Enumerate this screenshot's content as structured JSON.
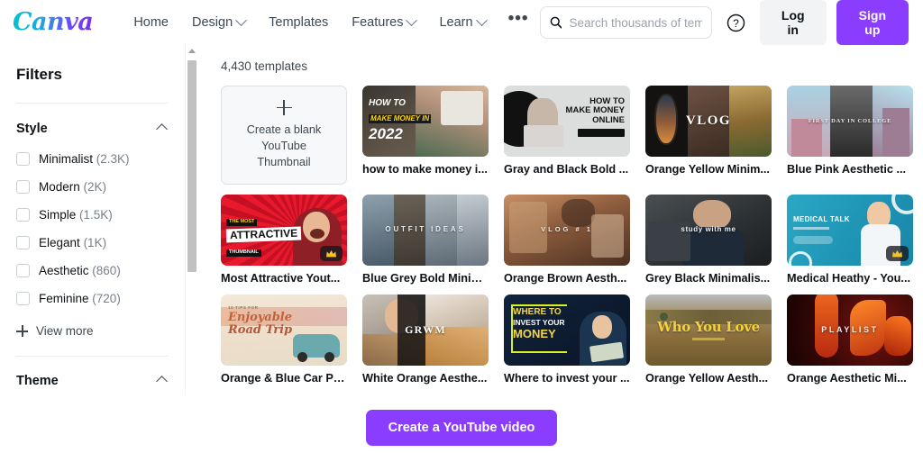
{
  "header": {
    "logo": "Canva",
    "nav": [
      {
        "label": "Home",
        "has_chevron": false
      },
      {
        "label": "Design",
        "has_chevron": true
      },
      {
        "label": "Templates",
        "has_chevron": false
      },
      {
        "label": "Features",
        "has_chevron": true
      },
      {
        "label": "Learn",
        "has_chevron": true
      }
    ],
    "more_glyph": "•••",
    "search": {
      "placeholder": "Search thousands of temp",
      "value": "",
      "icon": "search-icon"
    },
    "help_icon": "question-circle-icon",
    "login_label": "Log in",
    "signup_label": "Sign up",
    "signup_color": "#8b3dff"
  },
  "sidebar": {
    "title": "Filters",
    "sections": [
      {
        "label": "Style",
        "expanded": true,
        "options": [
          {
            "label": "Minimalist",
            "count": "(2.3K)",
            "checked": false
          },
          {
            "label": "Modern",
            "count": "(2K)",
            "checked": false
          },
          {
            "label": "Simple",
            "count": "(1.5K)",
            "checked": false
          },
          {
            "label": "Elegant",
            "count": "(1K)",
            "checked": false
          },
          {
            "label": "Aesthetic",
            "count": "(860)",
            "checked": false
          },
          {
            "label": "Feminine",
            "count": "(720)",
            "checked": false
          }
        ],
        "view_more_label": "View more"
      },
      {
        "label": "Theme",
        "expanded": true,
        "options": []
      }
    ]
  },
  "main": {
    "count_text": "4,430 templates",
    "blank_card": {
      "line1": "Create a blank",
      "line2": "YouTube",
      "line3": "Thumbnail",
      "icon": "plus-icon"
    },
    "templates": [
      {
        "title": "how to make money i...",
        "pro": false,
        "art": "money2022"
      },
      {
        "title": "Gray and Black Bold ...",
        "pro": false,
        "art": "makemoneyonline"
      },
      {
        "title": "Orange Yellow Minim...",
        "pro": false,
        "art": "vlog"
      },
      {
        "title": "Blue Pink Aesthetic ...",
        "pro": false,
        "art": "firstday"
      },
      {
        "title": "Most Attractive Yout...",
        "pro": true,
        "art": "attractive"
      },
      {
        "title": "Blue Grey Bold Minim...",
        "pro": false,
        "art": "outfitideas"
      },
      {
        "title": "Orange Brown Aesth...",
        "pro": false,
        "art": "vlog1"
      },
      {
        "title": "Grey Black Minimalis...",
        "pro": false,
        "art": "studywithme"
      },
      {
        "title": "Medical Heathy - You...",
        "pro": true,
        "art": "medicaltalk"
      },
      {
        "title": "Orange & Blue Car Ph...",
        "pro": false,
        "art": "roadtrip"
      },
      {
        "title": "White Orange Aesthe...",
        "pro": false,
        "art": "grwm"
      },
      {
        "title": "Where to invest your ...",
        "pro": false,
        "art": "whereinvest"
      },
      {
        "title": "Orange Yellow Aesth...",
        "pro": false,
        "art": "whoyoulove"
      },
      {
        "title": "Orange Aesthetic Mi...",
        "pro": false,
        "art": "playlist"
      }
    ],
    "thumb_text": {
      "money2022_l1": "HOW TO",
      "money2022_l2": "MAKE MONEY IN",
      "money2022_l3": "2022",
      "makemoneyonline_l1": "HOW TO",
      "makemoneyonline_l2": "MAKE MONEY",
      "makemoneyonline_l3": "ONLINE",
      "vlog": "VLOG",
      "firstday": "FIRST DAY IN COLLEGE",
      "attractive_l1": "THE MOST",
      "attractive_l2": "ATTRACTIVE",
      "attractive_l3": "THUMBNAIL",
      "outfitideas": "OUTFIT IDEAS",
      "vlog1": "VLOG  # 1",
      "studywithme": "study with me",
      "medicaltalk": "MEDICAL TALK",
      "roadtrip_l1": "10 TIPS FOR",
      "roadtrip_l2": "Enjoyable",
      "roadtrip_l3": "Road Trip",
      "grwm": "GRWM",
      "whereinvest_l1": "WHERE TO",
      "whereinvest_l2": "INVEST YOUR",
      "whereinvest_l3": "MONEY",
      "whoyoulove": "Who You Love",
      "playlist": "PLAYLIST"
    },
    "pro_badge_icon": "crown-icon"
  },
  "footer": {
    "cta_label": "Create a YouTube video",
    "cta_color": "#8b3dff"
  },
  "scrollbar": {
    "name": "vertical-scrollbar"
  }
}
